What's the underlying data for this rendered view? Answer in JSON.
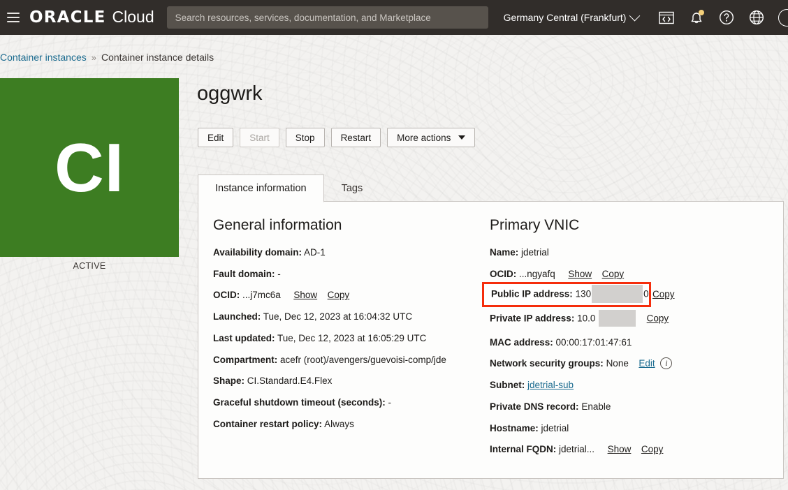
{
  "header": {
    "menu_icon": "hamburger-menu-icon",
    "brand_primary": "ORACLE",
    "brand_secondary": "Cloud",
    "search_placeholder": "Search resources, services, documentation, and Marketplace",
    "search_value": "",
    "region": "Germany Central (Frankfurt)",
    "icons": [
      "code-editor-icon",
      "notifications-bell-icon",
      "help-icon",
      "language-globe-icon",
      "user-avatar-icon"
    ],
    "notification_badge_color": "#f5d07a",
    "background_color": "#312d2a"
  },
  "breadcrumb": {
    "parent": "Container instances",
    "separator": "»",
    "current": "Container instance details"
  },
  "resource": {
    "badge_letters": "CI",
    "badge_color": "#3d7d22",
    "status": "ACTIVE",
    "title": "oggwrk"
  },
  "actions": {
    "edit": "Edit",
    "start": "Start",
    "stop": "Stop",
    "restart": "Restart",
    "more": "More actions"
  },
  "tabs": [
    {
      "label": "Instance information",
      "active": true
    },
    {
      "label": "Tags",
      "active": false
    }
  ],
  "general_information": {
    "heading": "General information",
    "availability_domain_label": "Availability domain:",
    "availability_domain_value": "AD-1",
    "fault_domain_label": "Fault domain:",
    "fault_domain_value": "-",
    "ocid_label": "OCID:",
    "ocid_value": "...j7mc6a",
    "ocid_show": "Show",
    "ocid_copy": "Copy",
    "launched_label": "Launched:",
    "launched_value": "Tue, Dec 12, 2023 at 16:04:32 UTC",
    "last_updated_label": "Last updated:",
    "last_updated_value": "Tue, Dec 12, 2023 at 16:05:29 UTC",
    "compartment_label": "Compartment:",
    "compartment_value": "acefr (root)/avengers/guevoisi-comp/jde",
    "shape_label": "Shape:",
    "shape_value": "CI.Standard.E4.Flex",
    "graceful_shutdown_label": "Graceful shutdown timeout (seconds):",
    "graceful_shutdown_value": "-",
    "restart_policy_label": "Container restart policy:",
    "restart_policy_value": "Always"
  },
  "primary_vnic": {
    "heading": "Primary VNIC",
    "name_label": "Name:",
    "name_value": "jdetrial",
    "ocid_label": "OCID:",
    "ocid_value": "...ngyafq",
    "ocid_show": "Show",
    "ocid_copy": "Copy",
    "public_ip_label": "Public IP address:",
    "public_ip_value": "130",
    "public_ip_suffix": "0",
    "public_ip_copy": "Copy",
    "public_ip_redacted": true,
    "private_ip_label": "Private IP address:",
    "private_ip_value": "10.0",
    "private_ip_copy": "Copy",
    "private_ip_redacted": true,
    "mac_label": "MAC address:",
    "mac_value": "00:00:17:01:47:61",
    "nsg_label": "Network security groups:",
    "nsg_value": "None",
    "nsg_edit": "Edit",
    "nsg_info_icon": "info-circle-icon",
    "subnet_label": "Subnet:",
    "subnet_value": "jdetrial-sub",
    "dns_label": "Private DNS record:",
    "dns_value": "Enable",
    "hostname_label": "Hostname:",
    "hostname_value": "jdetrial",
    "fqdn_label": "Internal FQDN:",
    "fqdn_value": "jdetrial...",
    "fqdn_show": "Show",
    "fqdn_copy": "Copy"
  },
  "annotation": {
    "highlight_color": "#f52d0c",
    "highlight_target": "public-ip-address-row"
  }
}
